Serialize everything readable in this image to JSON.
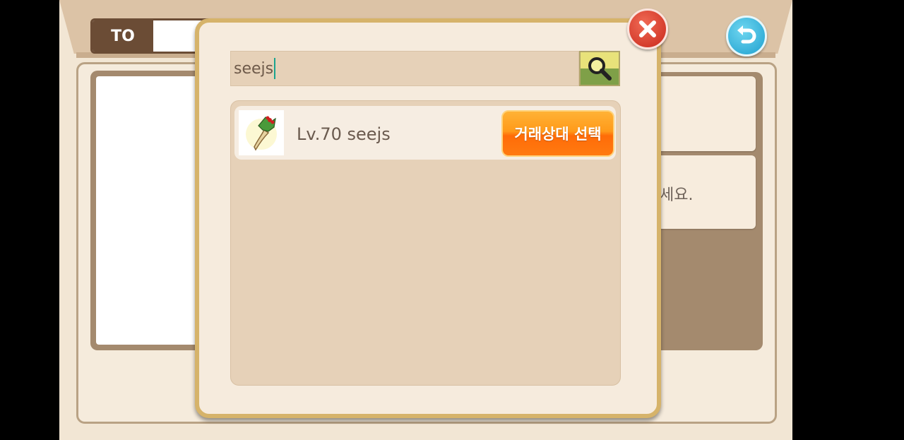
{
  "header": {
    "to_label": "TO"
  },
  "background": {
    "hint_text": "세요."
  },
  "dialog": {
    "search": {
      "value": "seejs"
    },
    "results": [
      {
        "level_name": "Lv.70 seejs",
        "select_label": "거래상대 선택"
      }
    ]
  },
  "icons": {
    "close": "close-icon",
    "back": "back-arrow-icon",
    "search": "magnifier-icon",
    "avatar": "ginseng-avatar-icon"
  },
  "colors": {
    "dialog_border": "#d6b36a",
    "close_button": "#c9281b",
    "back_button": "#1ea0cf",
    "select_button": "#ff7a10"
  }
}
